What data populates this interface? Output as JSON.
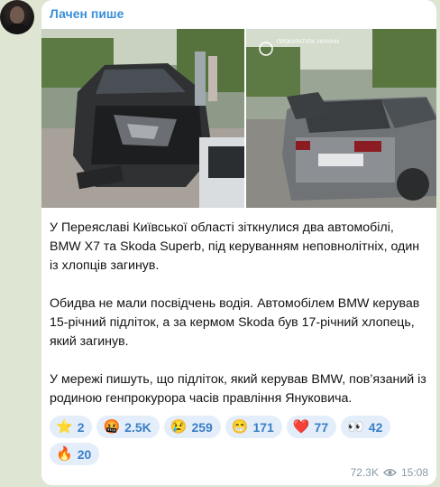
{
  "channel": {
    "name": "Лачен пише"
  },
  "message": {
    "paragraphs": [
      "У Переяславі Київської області зіткнулися два автомобілі, BMW X7 та Skoda Superb, під керуванням неповнолітніх, один із хлопців загинув.",
      "Обидва не мали посвідчень водія. Автомобілем BMW керував 15-річний підліток, а за кермом Skoda був 17-річний хлопець, який загинув.",
      "У мережі пишуть, що підліток, який керував BMW, пов’язаний із родиною генпрокурора часів правління Януковича."
    ],
    "reactions": [
      {
        "emoji": "⭐",
        "count": "2",
        "icon": "star-icon"
      },
      {
        "emoji": "🤬",
        "count": "2.5K",
        "icon": "angry-face-icon"
      },
      {
        "emoji": "😢",
        "count": "259",
        "icon": "crying-face-icon"
      },
      {
        "emoji": "😁",
        "count": "171",
        "icon": "grinning-face-icon"
      },
      {
        "emoji": "❤️",
        "count": "77",
        "icon": "heart-icon"
      },
      {
        "emoji": "👀",
        "count": "42",
        "icon": "eyes-icon"
      },
      {
        "emoji": "🔥",
        "count": "20",
        "icon": "fire-icon"
      }
    ],
    "views": "72.3K",
    "time": "15:08",
    "watermark": "ПРОКУРАТУРА УКРАЇНИ"
  },
  "colors": {
    "accent": "#3a8fd8",
    "reaction_bg": "#e3eefa",
    "chat_bg": "#dfe5d3"
  }
}
